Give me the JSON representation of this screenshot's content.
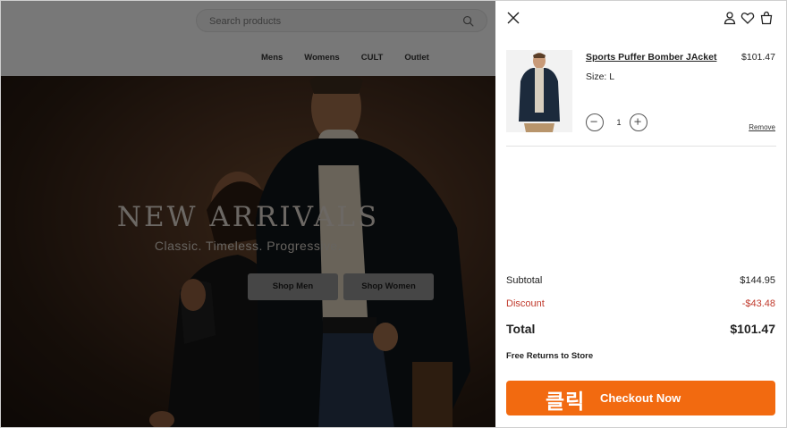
{
  "page": {
    "search": {
      "placeholder": "Search products",
      "value": ""
    },
    "nav": [
      "Mens",
      "Womens",
      "CULT",
      "Outlet"
    ],
    "hero": {
      "title": "NEW ARRIVALS",
      "subtitle": "Classic. Timeless. Progressive.",
      "buttons": [
        "Shop Men",
        "Shop Women"
      ]
    }
  },
  "cart": {
    "item": {
      "name": "Sports Puffer Bomber JAcket",
      "price": "$101.47",
      "size": "Size: L",
      "quantity": "1",
      "remove_label": "Remove"
    },
    "summary": {
      "subtotal_label": "Subtotal",
      "subtotal_value": "$144.95",
      "discount_label": "Discount",
      "discount_value": "-$43.48",
      "total_label": "Total",
      "total_value": "$101.47"
    },
    "free_returns": "Free Returns to Store",
    "checkout_label": "Checkout Now",
    "click_annotation": "클릭"
  },
  "colors": {
    "accent": "#f26a10",
    "discount": "#c0392b"
  },
  "icons": [
    "search-icon",
    "close-icon",
    "user-icon",
    "heart-icon",
    "bag-icon",
    "minus-icon",
    "plus-icon"
  ]
}
